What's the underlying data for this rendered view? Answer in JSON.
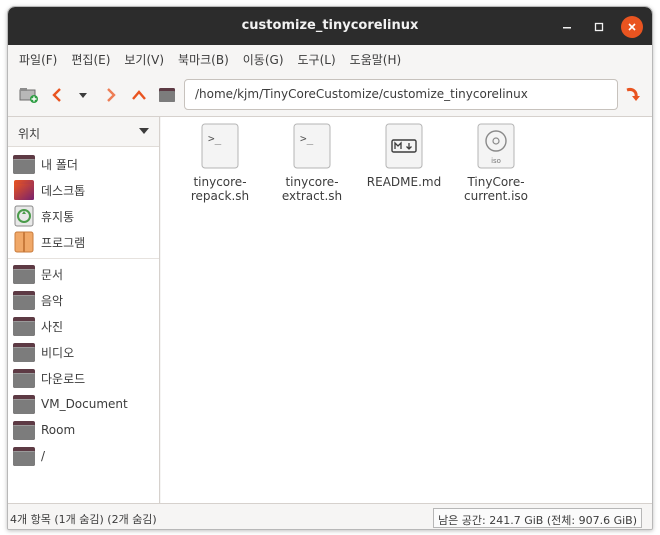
{
  "window": {
    "title": "customize_tinycorelinux"
  },
  "menu": [
    "파일(F)",
    "편집(E)",
    "보기(V)",
    "북마크(B)",
    "이동(G)",
    "도구(L)",
    "도움말(H)"
  ],
  "toolbar": {
    "buttons": [
      "new-folder-icon",
      "back-icon",
      "history-dropdown-icon",
      "forward-icon",
      "up-icon",
      "folder-icon",
      "reload-icon"
    ],
    "path": "/home/kjm/TinyCoreCustomize/customize_tinycorelinux"
  },
  "sidebar": {
    "header": "위치",
    "places": [
      {
        "label": "내 폴더",
        "icon": "home-folder-icon"
      },
      {
        "label": "데스크톱",
        "icon": "desktop-icon"
      },
      {
        "label": "휴지통",
        "icon": "trash-icon"
      },
      {
        "label": "프로그램",
        "icon": "applications-icon"
      }
    ],
    "bookmarks": [
      {
        "label": "문서",
        "icon": "folder-icon"
      },
      {
        "label": "음악",
        "icon": "folder-icon"
      },
      {
        "label": "사진",
        "icon": "folder-icon"
      },
      {
        "label": "비디오",
        "icon": "folder-icon"
      },
      {
        "label": "다운로드",
        "icon": "folder-icon"
      },
      {
        "label": "VM_Document",
        "icon": "folder-icon"
      },
      {
        "label": "Room",
        "icon": "folder-icon"
      },
      {
        "label": "/",
        "icon": "folder-icon"
      }
    ]
  },
  "files": [
    {
      "name_line1": "tinycore-",
      "name_line2": "repack.sh",
      "icon": "shell-script-icon"
    },
    {
      "name_line1": "tinycore-",
      "name_line2": "extract.sh",
      "icon": "shell-script-icon"
    },
    {
      "name_line1": "README.md",
      "name_line2": "",
      "icon": "markdown-file-icon"
    },
    {
      "name_line1": "TinyCore-",
      "name_line2": "current.iso",
      "icon": "iso-disc-icon",
      "badge": "iso"
    }
  ],
  "status": {
    "left": "4개 항목 (1개 숨김) (2개 숨김)",
    "right": "남은 공간: 241.7 GiB (전체: 907.6 GiB)"
  }
}
